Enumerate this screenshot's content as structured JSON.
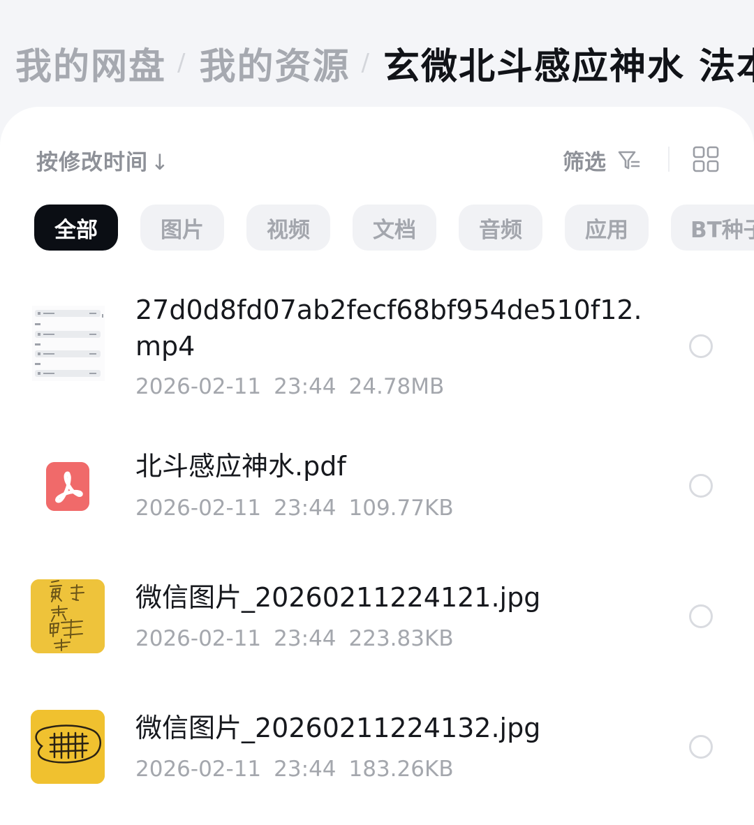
{
  "breadcrumb": {
    "items": [
      "我的网盘",
      "我的资源"
    ],
    "separator": "/",
    "current": "玄微北斗感应神水 法本"
  },
  "toolbar": {
    "sort_label": "按修改时间",
    "sort_arrow": "↓",
    "filter_label": "筛选",
    "filter_icon": "filter-icon",
    "view_icon": "grid-view-icon"
  },
  "categories": [
    {
      "label": "全部",
      "active": true
    },
    {
      "label": "图片",
      "active": false
    },
    {
      "label": "视频",
      "active": false
    },
    {
      "label": "文档",
      "active": false
    },
    {
      "label": "音频",
      "active": false
    },
    {
      "label": "应用",
      "active": false
    },
    {
      "label": "BT种子",
      "active": false
    }
  ],
  "files": [
    {
      "name": "27d0d8fd07ab2fecf68bf954de510f12.mp4",
      "date": "2026-02-11",
      "time": "23:44",
      "size": "24.78MB",
      "thumb": "video-thumbnail"
    },
    {
      "name": "北斗感应神水.pdf",
      "date": "2026-02-11",
      "time": "23:44",
      "size": "109.77KB",
      "thumb": "pdf-file-icon"
    },
    {
      "name": "微信图片_20260211224121.jpg",
      "date": "2026-02-11",
      "time": "23:44",
      "size": "223.83KB",
      "thumb": "image-thumbnail"
    },
    {
      "name": "微信图片_20260211224132.jpg",
      "date": "2026-02-11",
      "time": "23:44",
      "size": "183.26KB",
      "thumb": "image-thumbnail"
    }
  ],
  "colors": {
    "active_chip_bg": "#0b0e14",
    "pdf_icon": "#f06a6a",
    "image_thumb_yellow": "#eec33b"
  }
}
